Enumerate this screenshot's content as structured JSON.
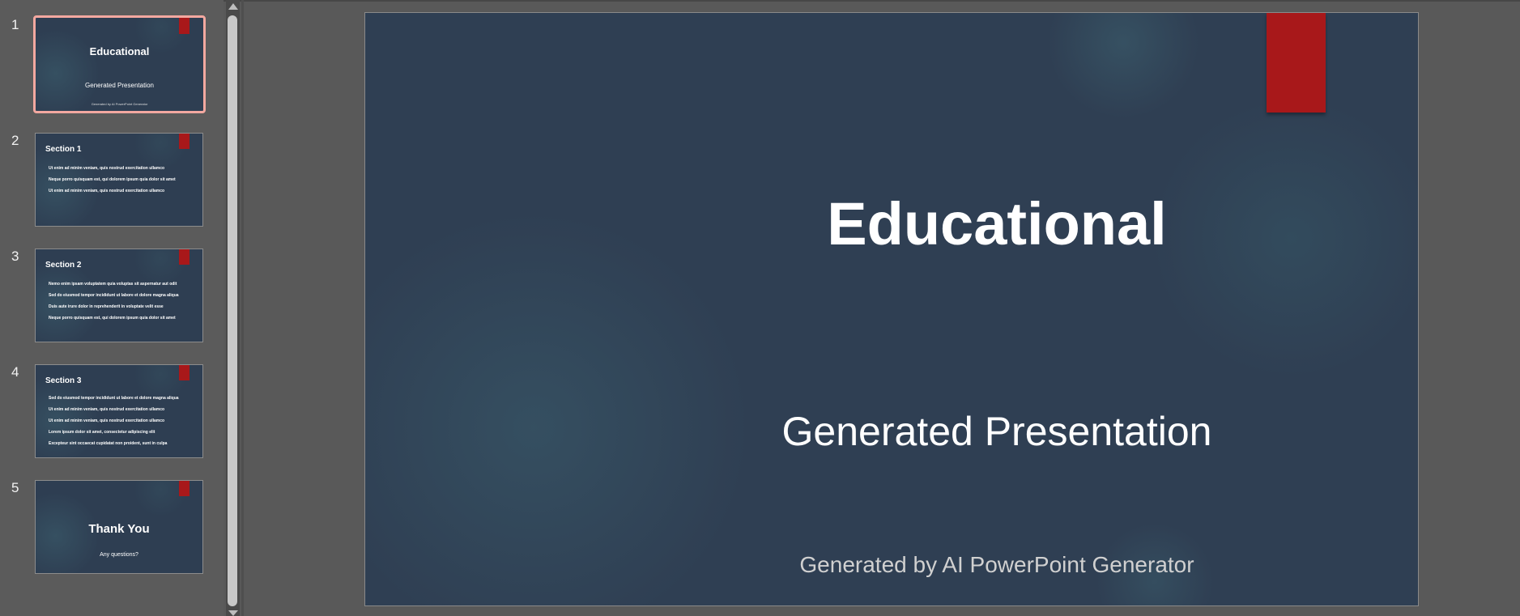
{
  "thumbnails": [
    {
      "number": "1",
      "title": "Educational",
      "subtitle": "Generated Presentation",
      "footer": "Generated by AI PowerPoint Generator"
    },
    {
      "number": "2",
      "heading": "Section 1",
      "bullets": [
        "Ut enim ad minim veniam, quis nostrud exercitation ullamco",
        "Neque porro quisquam est, qui dolorem ipsum quia dolor sit amet",
        "Ut enim ad minim veniam, quis nostrud exercitation ullamco"
      ]
    },
    {
      "number": "3",
      "heading": "Section 2",
      "bullets": [
        "Nemo enim ipsam voluptatem quia voluptas sit aspernatur aut odit",
        "Sed do eiusmod tempor incididunt ut labore et dolore magna aliqua",
        "Duis aute irure dolor in reprehenderit in voluptate velit esse",
        "Neque porro quisquam est, qui dolorem ipsum quia dolor sit amet"
      ]
    },
    {
      "number": "4",
      "heading": "Section 3",
      "bullets": [
        "Sed do eiusmod tempor incididunt ut labore et dolore magna aliqua",
        "Ut enim ad minim veniam, quis nostrud exercitation ullamco",
        "Ut enim ad minim veniam, quis nostrud exercitation ullamco",
        "Lorem ipsum dolor sit amet, consectetur adipiscing elit",
        "Excepteur sint occaecat cupidatat non proident, sunt in culpa"
      ]
    },
    {
      "number": "5",
      "title": "Thank You",
      "subtitle": "Any questions?"
    }
  ],
  "main_slide": {
    "title": "Educational",
    "subtitle": "Generated Presentation",
    "footer": "Generated by AI PowerPoint Generator"
  },
  "colors": {
    "slide_background": "#2f3f53",
    "accent_ribbon": "#a8181a",
    "selection_border": "#f3a8a0"
  },
  "icons": {
    "scroll_up": "chevron-up-icon",
    "scroll_down": "chevron-down-icon"
  }
}
